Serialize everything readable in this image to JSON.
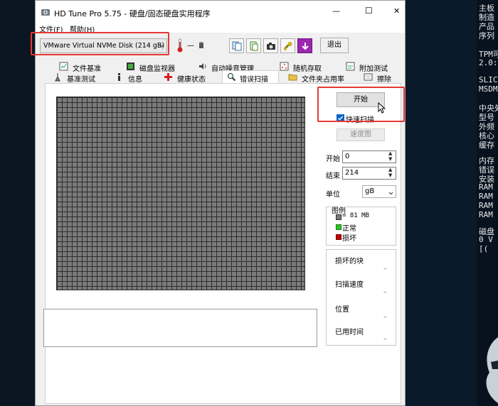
{
  "window": {
    "title": "HD Tune Pro 5.75 - 硬盘/固态硬盘实用程序",
    "minimize_glyph": "—",
    "maximize_glyph": "☐",
    "close_glyph": "✕"
  },
  "menu": {
    "file": "文件(F)",
    "help": "帮助(H)"
  },
  "toolbar": {
    "disk_select": "VMware Virtual NVMe Disk (214 gB)",
    "temperature": "—",
    "exit_label": "退出"
  },
  "tabs_row1": [
    "文件基准",
    "磁盘监视器",
    "自动噪音管理",
    "随机存取",
    "附加测试"
  ],
  "tabs_row2": [
    "基准测试",
    "信息",
    "健康状态",
    "错误扫描",
    "文件夹占用率",
    "擦除"
  ],
  "scan": {
    "start_button": "开始",
    "quick_scan_label": "快速扫描",
    "quick_scan_checked": true,
    "speed_map_button": "速度图",
    "start_label": "开始",
    "start_value": "0",
    "end_label": "结束",
    "end_value": "214",
    "unit_label": "单位",
    "unit_value": "gB",
    "legend_title": "图例",
    "legend_block": "= 81 MB",
    "legend_ok": "正常",
    "legend_bad": "损坏",
    "stats": [
      {
        "label": "损坏的块",
        "value": "–"
      },
      {
        "label": "扫描速度",
        "value": "–"
      },
      {
        "label": "位置",
        "value": "–"
      },
      {
        "label": "已用时间",
        "value": "–"
      }
    ]
  },
  "colors": {
    "block_gray": "#7b7b7b",
    "ok_green": "#27c427",
    "bad_red": "#c40000",
    "highlight_red": "#e53935",
    "accent_blue": "#0a64c8"
  },
  "background_text": [
    "主板",
    "制造",
    "产品",
    "序列",
    "TPM可",
    "2.0:",
    "SLIC",
    "MSDM",
    "中央处",
    "型号",
    "外频",
    "核心",
    "缓存",
    "内存",
    "错误",
    "安装",
    "RAM",
    "RAM",
    "RAM",
    "RAM",
    "磁盘",
    "0  V",
    "[("
  ]
}
